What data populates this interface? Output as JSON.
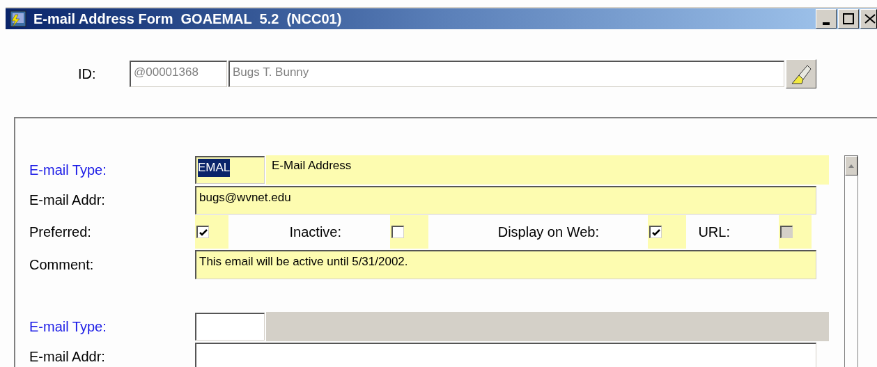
{
  "window": {
    "title": "E-mail Address Form  GOAEMAL  5.2  (NCC01)"
  },
  "key_block": {
    "label": "ID:",
    "id_value": "@00001368",
    "name_value": "Bugs T. Bunny"
  },
  "records": [
    {
      "current": true,
      "type_label": "E-mail Type:",
      "type_code": "EMAL",
      "code_selected": true,
      "type_description": "E-Mail Address",
      "addr_label": "E-mail Addr:",
      "addr_value": "bugs@wvnet.edu",
      "checkboxes": [
        {
          "label": "Preferred:",
          "checked": true,
          "disabled": false
        },
        {
          "label": "Inactive:",
          "checked": false,
          "disabled": false
        },
        {
          "label": "Display on Web:",
          "checked": true,
          "disabled": false
        },
        {
          "label": "URL:",
          "checked": false,
          "disabled": true
        }
      ],
      "comment_label": "Comment:",
      "comment_value": "This email will be active until 5/31/2002."
    },
    {
      "current": false,
      "type_label": "E-mail Type:",
      "addr_label": "E-mail Addr:"
    }
  ]
}
